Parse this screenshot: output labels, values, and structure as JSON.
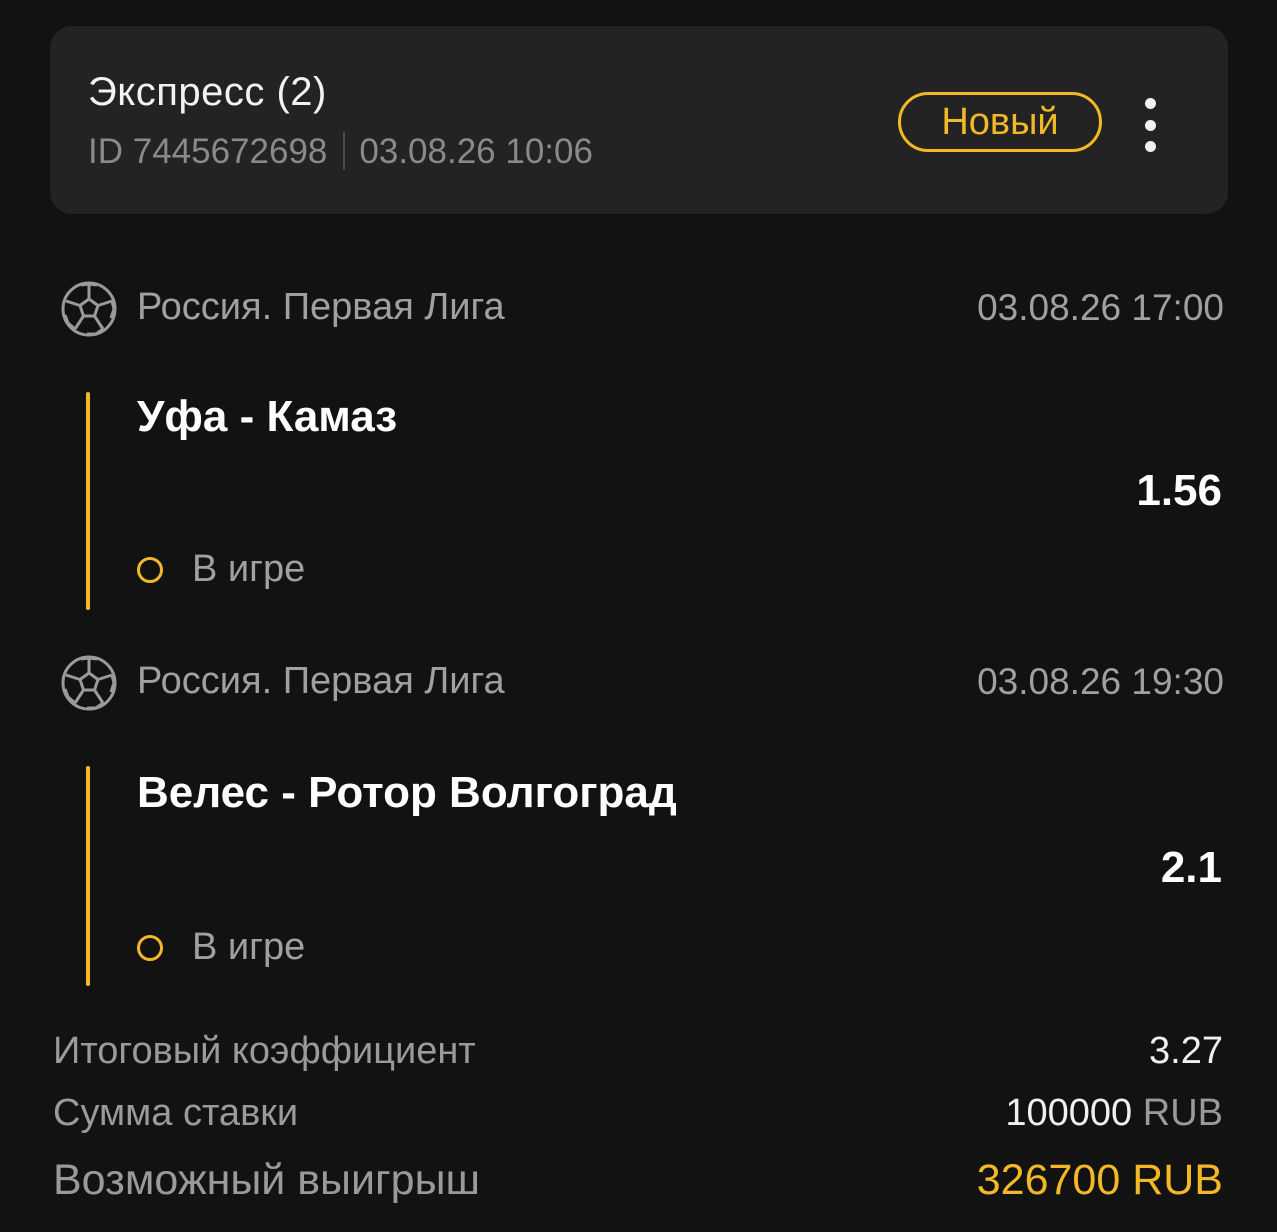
{
  "header": {
    "bet_type": "Экспресс (2)",
    "bet_id": "ID 7445672698",
    "bet_datetime": "03.08.26 10:06",
    "status_badge": "Новый"
  },
  "events": [
    {
      "sport_icon": "soccer-ball-icon",
      "league": "Россия. Первая Лига",
      "date": "03.08.26 17:00",
      "match": "Уфа - Камаз",
      "odds": "1.56",
      "status": "В игре"
    },
    {
      "sport_icon": "soccer-ball-icon",
      "league": "Россия. Первая Лига",
      "date": "03.08.26 19:30",
      "match": "Велес - Ротор Волгоград",
      "odds": "2.1",
      "status": "В игре"
    }
  ],
  "summary": {
    "total_odds_label": "Итоговый коэффициент",
    "total_odds_value": "3.27",
    "stake_label": "Сумма ставки",
    "stake_value": "100000",
    "stake_currency": "RUB",
    "win_label": "Возможный выигрыш",
    "win_value": "326700 RUB"
  },
  "colors": {
    "accent": "#f2b826",
    "background": "#121212",
    "card": "#232323"
  }
}
